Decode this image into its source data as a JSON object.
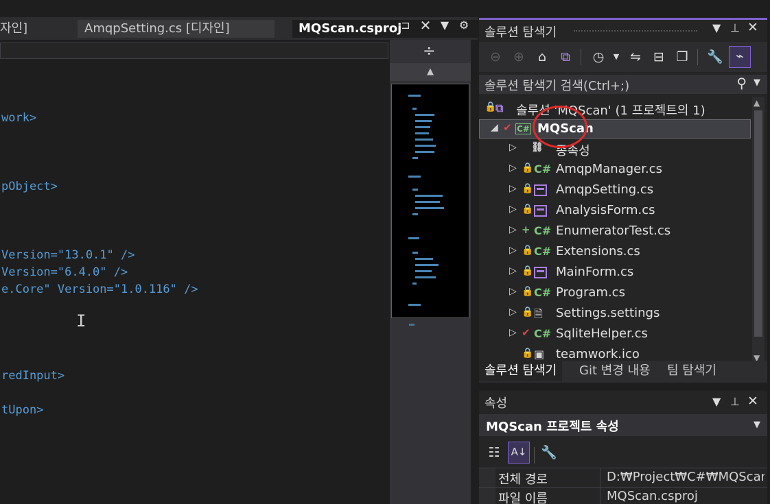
{
  "editor": {
    "tabs": [
      {
        "label": "자인]"
      },
      {
        "label": "AmqpSetting.cs [디자인]"
      },
      {
        "label": "MQScan.csproj"
      }
    ],
    "tab_icons": {
      "pin": "pin-icon",
      "close": "close-icon",
      "dropdown": "dropdown-icon",
      "settings": "gear-icon"
    },
    "code_lines": [
      {
        "text": "work>"
      },
      {
        "text": "pObject>"
      },
      {
        "text": "Version=\"13.0.1\" />"
      },
      {
        "text": "Version=\"6.4.0\" />"
      },
      {
        "text": "e.Core\" Version=\"1.0.116\" />"
      },
      {
        "text": "redInput>"
      },
      {
        "text": "tUpon>"
      }
    ]
  },
  "solution_explorer": {
    "title": "솔루션 탐색기",
    "search_placeholder": "솔루션 탐색기 검색(Ctrl+;)",
    "solution_label": "솔루션 'MQScan' (1 프로젝트의 1)",
    "project_label": "MQScan",
    "items": [
      {
        "label": "종속성",
        "icon": "dependencies-icon"
      },
      {
        "label": "AmqpManager.cs",
        "icon": "csharp-file-icon"
      },
      {
        "label": "AmqpSetting.cs",
        "icon": "form-icon"
      },
      {
        "label": "AnalysisForm.cs",
        "icon": "form-icon"
      },
      {
        "label": "EnumeratorTest.cs",
        "icon": "csharp-file-icon"
      },
      {
        "label": "Extensions.cs",
        "icon": "csharp-file-icon"
      },
      {
        "label": "MainForm.cs",
        "icon": "form-icon"
      },
      {
        "label": "Program.cs",
        "icon": "csharp-file-icon"
      },
      {
        "label": "Settings.settings",
        "icon": "settings-file-icon"
      },
      {
        "label": "SqliteHelper.cs",
        "icon": "csharp-file-icon"
      },
      {
        "label": "teamwork.ico",
        "icon": "ico-file-icon"
      }
    ],
    "bottom_tabs": [
      "솔루션 탐색기",
      "Git 변경 내용",
      "팀 탐색기"
    ]
  },
  "properties": {
    "title": "속성",
    "object_label": "MQScan 프로젝트 속성",
    "rows": [
      {
        "name": "전체 경로",
        "value": "D:₩Project₩C#₩MQScan₩"
      },
      {
        "name": "파일 이름",
        "value": "MQScan.csproj"
      }
    ]
  },
  "colors": {
    "accent": "#8060d0",
    "highlight_circle": "#e02a2a",
    "csharp_icon": "#7ec87e",
    "keyword": "#569cd6"
  }
}
